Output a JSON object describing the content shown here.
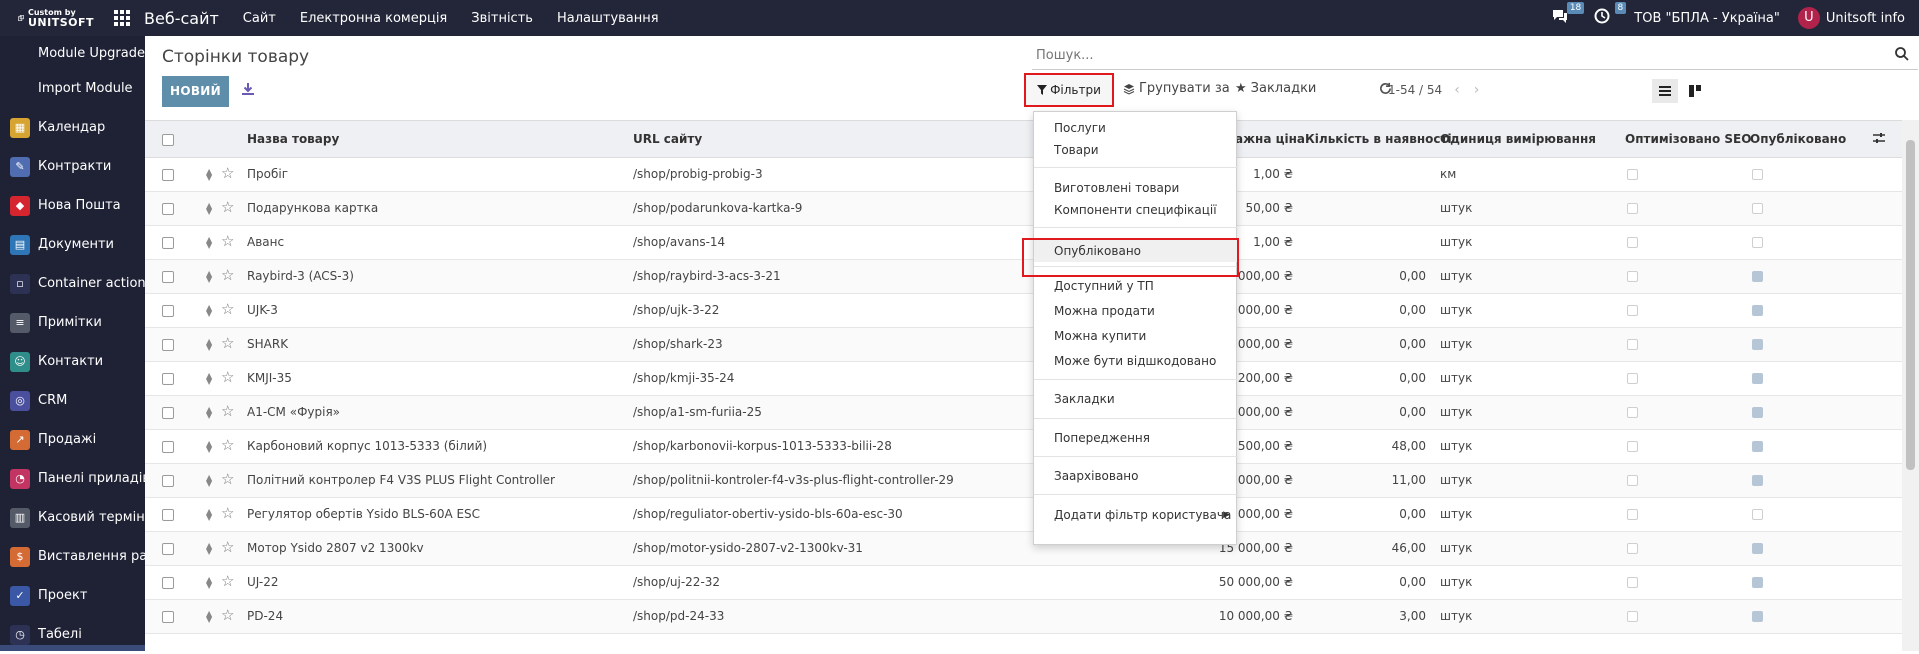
{
  "topbar": {
    "logo_top": "Custom by",
    "logo_bottom": "UNITSOFT",
    "app_name": "Веб-сайт",
    "menu": [
      "Сайт",
      "Електронна комерція",
      "Звітність",
      "Налаштування"
    ],
    "chat_badge": "18",
    "activity_badge": "8",
    "company": "ТОВ \"БПЛА - Україна\"",
    "avatar_letter": "U",
    "user": "Unitsoft info"
  },
  "sidebar": {
    "items": [
      {
        "label": "Module Upgrade",
        "icon": "",
        "color": ""
      },
      {
        "label": "Import Module",
        "icon": "",
        "color": ""
      },
      {
        "label": "Календар",
        "icon": "calendar-icon",
        "color": "#d7a431"
      },
      {
        "label": "Контракти",
        "icon": "contract-icon",
        "color": "#4f6db0"
      },
      {
        "label": "Нова Пошта",
        "icon": "nova-poshta-icon",
        "color": "#d5252f"
      },
      {
        "label": "Документи",
        "icon": "documents-icon",
        "color": "#2f76b7"
      },
      {
        "label": "Container actions",
        "icon": "container-icon",
        "color": "#2d3254"
      },
      {
        "label": "Примітки",
        "icon": "notes-icon",
        "color": "#555a68"
      },
      {
        "label": "Контакти",
        "icon": "contacts-icon",
        "color": "#2f8d8a"
      },
      {
        "label": "CRM",
        "icon": "crm-icon",
        "color": "#4a4f9e"
      },
      {
        "label": "Продажі",
        "icon": "sales-icon",
        "color": "#d46b35"
      },
      {
        "label": "Панелі приладів",
        "icon": "dashboard-icon",
        "color": "#c23461"
      },
      {
        "label": "Касовий термін...",
        "icon": "pos-icon",
        "color": "#555a68"
      },
      {
        "label": "Виставлення ра...",
        "icon": "invoice-icon",
        "color": "#d46b35"
      },
      {
        "label": "Проект",
        "icon": "project-icon",
        "color": "#3a58a6"
      },
      {
        "label": "Табелі",
        "icon": "timesheet-icon",
        "color": "#2d3254"
      }
    ]
  },
  "page": {
    "breadcrumb": "Сторінки товару",
    "new_button": "НОВИЙ",
    "search_placeholder": "Пошук...",
    "filters_label": "Фільтри",
    "group_label": "Групувати за",
    "favorites_label": "Закладки",
    "pager": "1-54 / 54"
  },
  "table": {
    "headers": {
      "name": "Назва товару",
      "url": "URL сайту",
      "price": "ажна ціна",
      "qty": "Кількість в наявності",
      "uom": "Одиниця вимірювання",
      "seo": "Оптимізовано SEO",
      "published": "Опубліковано"
    },
    "rows": [
      {
        "name": "Пробіг",
        "url": "/shop/probig-probig-3",
        "price": "1,00 ₴",
        "qty": "",
        "uom": "км",
        "published": false
      },
      {
        "name": "Подарункова картка",
        "url": "/shop/podarunkova-kartka-9",
        "price": "50,00 ₴",
        "qty": "",
        "uom": "штук",
        "published": false
      },
      {
        "name": "Аванс",
        "url": "/shop/avans-14",
        "price": "1,00 ₴",
        "qty": "",
        "uom": "штук",
        "published": false
      },
      {
        "name": "Raybird-3 (ACS-3)",
        "url": "/shop/raybird-3-acs-3-21",
        "price": "000,00 ₴",
        "qty": "0,00",
        "uom": "штук",
        "published": true
      },
      {
        "name": "UJK-3",
        "url": "/shop/ujk-3-22",
        "price": "0 000,00 ₴",
        "qty": "0,00",
        "uom": "штук",
        "published": true
      },
      {
        "name": "SHARK",
        "url": "/shop/shark-23",
        "price": "2 000,00 ₴",
        "qty": "0,00",
        "uom": "штук",
        "published": true
      },
      {
        "name": "KMJI-35",
        "url": "/shop/kmji-35-24",
        "price": "5 200,00 ₴",
        "qty": "0,00",
        "uom": "штук",
        "published": true
      },
      {
        "name": "A1-CM «Фурія»",
        "url": "/shop/a1-sm-furiia-25",
        "price": "0 000,00 ₴",
        "qty": "0,00",
        "uom": "штук",
        "published": true
      },
      {
        "name": "Карбоновий корпус 1013-5333 (білий)",
        "url": "/shop/karbonovii-korpus-1013-5333-bilii-28",
        "price": "7 500,00 ₴",
        "qty": "48,00",
        "uom": "штук",
        "published": true
      },
      {
        "name": "Політний контролер F4 V3S PLUS Flight Controller",
        "url": "/shop/politnii-kontroler-f4-v3s-plus-flight-controller-29",
        "price": "0 000,00 ₴",
        "qty": "11,00",
        "uom": "штук",
        "published": true
      },
      {
        "name": "Регулятор обертів Ysido BLS-60A ESC",
        "url": "/shop/reguliator-obertiv-ysido-bls-60a-esc-30",
        "price": "1 000,00 ₴",
        "qty": "0,00",
        "uom": "штук",
        "published": false
      },
      {
        "name": "Мотор Ysido 2807 v2 1300kv",
        "url": "/shop/motor-ysido-2807-v2-1300kv-31",
        "price": "15 000,00 ₴",
        "qty": "46,00",
        "uom": "штук",
        "published": true
      },
      {
        "name": "UJ-22",
        "url": "/shop/uj-22-32",
        "price": "50 000,00 ₴",
        "qty": "0,00",
        "uom": "штук",
        "published": true
      },
      {
        "name": "PD-24",
        "url": "/shop/pd-24-33",
        "price": "10 000,00 ₴",
        "qty": "3,00",
        "uom": "штук",
        "published": true
      }
    ]
  },
  "filter_menu": {
    "items": [
      "Послуги",
      "Товари",
      "Виготовлені товари",
      "Компоненти специфікації",
      "Опубліковано",
      "Доступний у ТП",
      "Можна продати",
      "Можна купити",
      "Може бути відшкодовано",
      "Закладки",
      "Попередження",
      "Заархівовано",
      "Додати фільтр користувача"
    ]
  }
}
